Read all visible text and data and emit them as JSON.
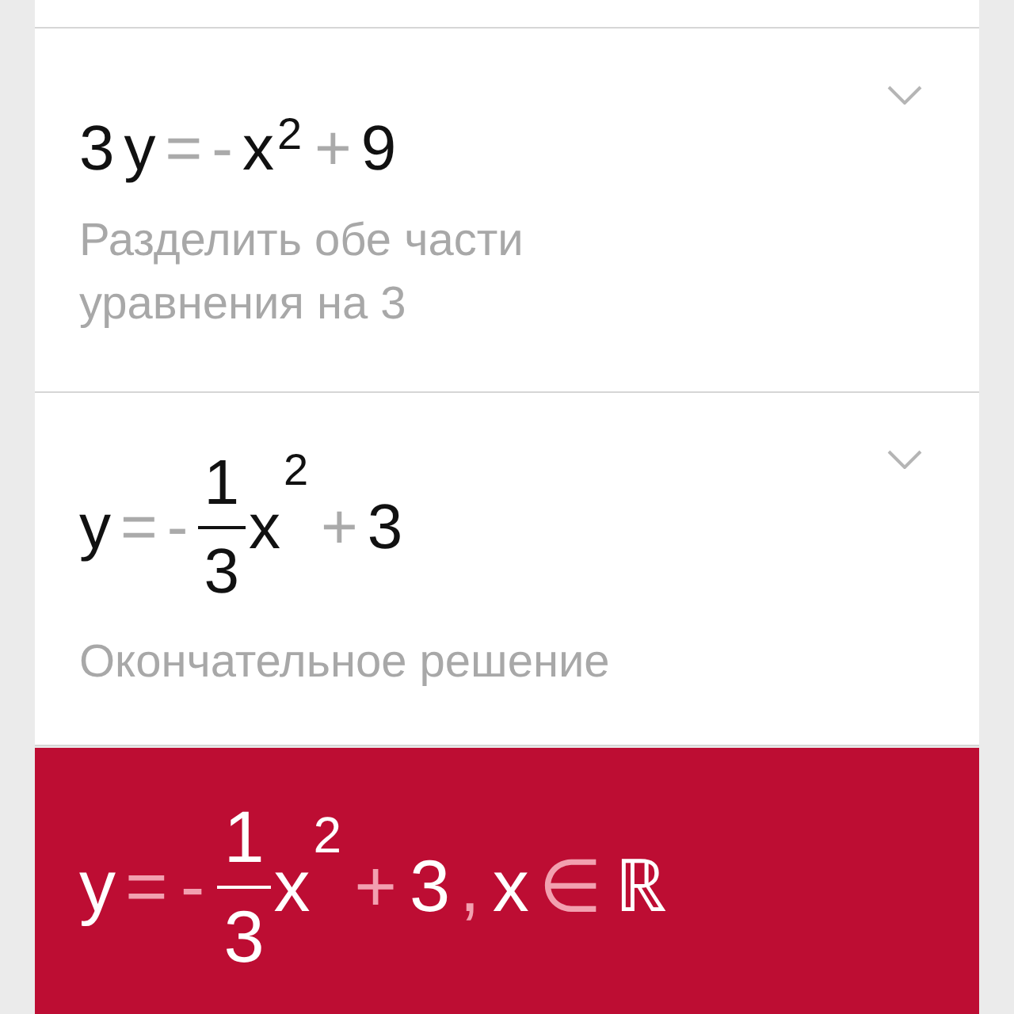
{
  "steps": [
    {
      "expanded": false,
      "equation": [
        {
          "kind": "term",
          "text": "3"
        },
        {
          "kind": "term",
          "text": "y"
        },
        {
          "kind": "op",
          "text": "="
        },
        {
          "kind": "op",
          "text": "-"
        },
        {
          "kind": "term",
          "text": "x"
        },
        {
          "kind": "sup",
          "text": "2"
        },
        {
          "kind": "op",
          "text": "+"
        },
        {
          "kind": "term",
          "text": "9"
        }
      ],
      "note": "Разделить обе части уравнения на 3"
    },
    {
      "expanded": false,
      "equation": [
        {
          "kind": "term",
          "text": "y"
        },
        {
          "kind": "op",
          "text": "="
        },
        {
          "kind": "op",
          "text": "-"
        },
        {
          "kind": "frac",
          "num": "1",
          "den": "3"
        },
        {
          "kind": "term",
          "text": "x"
        },
        {
          "kind": "sup",
          "text": "2"
        },
        {
          "kind": "op",
          "text": "+"
        },
        {
          "kind": "term",
          "text": "3"
        }
      ],
      "note": "Окончательное решение"
    }
  ],
  "result": {
    "equation": [
      {
        "kind": "term",
        "text": "y"
      },
      {
        "kind": "op",
        "text": "="
      },
      {
        "kind": "op",
        "text": "-"
      },
      {
        "kind": "frac",
        "num": "1",
        "den": "3"
      },
      {
        "kind": "term",
        "text": "x"
      },
      {
        "kind": "sup",
        "text": "2"
      },
      {
        "kind": "op",
        "text": "+"
      },
      {
        "kind": "term",
        "text": "3"
      },
      {
        "kind": "op",
        "text": ","
      },
      {
        "kind": "term",
        "text": "x"
      },
      {
        "kind": "op",
        "text": "∈"
      },
      {
        "kind": "term",
        "text": "ℝ"
      }
    ]
  }
}
